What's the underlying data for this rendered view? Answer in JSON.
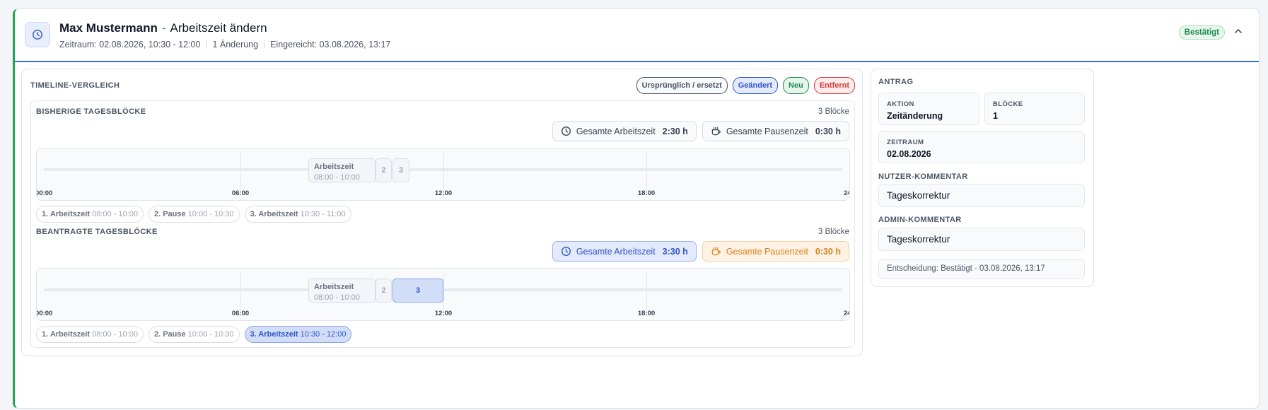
{
  "header": {
    "name": "Max Mustermann",
    "separator": "-",
    "title": "Arbeitszeit ändern",
    "period": "Zeitraum: 02.08.2026, 10:30 - 12:00",
    "changes": "1 Änderung",
    "submitted": "Eingereicht: 03.08.2026, 13:17",
    "status": "Bestätigt",
    "icons": {
      "main": "clock-icon",
      "collapse": "chevron-up-icon"
    }
  },
  "comparison": {
    "title": "Timeline-Vergleich",
    "legend": [
      "Ursprünglich / ersetzt",
      "Geändert",
      "Neu",
      "Entfernt"
    ],
    "colors": {
      "changed": "#2f56c6",
      "new": "#1f8a4c",
      "removed": "#d83a3a",
      "pause": "#d9821d"
    },
    "ticks": [
      "00:00",
      "06:00",
      "12:00",
      "18:00",
      "24:00"
    ],
    "previous": {
      "title": "Bisherige Tagesblöcke",
      "count": "3 Blöcke",
      "total_work_label": "Gesamte Arbeitszeit",
      "total_work_value": "2:30 h",
      "total_pause_label": "Gesamte Pausenzeit",
      "total_pause_value": "0:30 h",
      "segments": {
        "work_label": "Arbeitszeit",
        "work_range": "08:00 - 10:00",
        "b2": "2",
        "b3": "3"
      },
      "chips": [
        {
          "name": "1. Arbeitszeit",
          "range": "08:00 - 10:00"
        },
        {
          "name": "2. Pause",
          "range": "10:00 - 10:30"
        },
        {
          "name": "3. Arbeitszeit",
          "range": "10:30 - 11:00"
        }
      ]
    },
    "requested": {
      "title": "Beantragte Tagesblöcke",
      "count": "3 Blöcke",
      "total_work_label": "Gesamte Arbeitszeit",
      "total_work_value": "3:30 h",
      "total_pause_label": "Gesamte Pausenzeit",
      "total_pause_value": "0:30 h",
      "segments": {
        "work_label": "Arbeitszeit",
        "work_range": "08:00 - 10:00",
        "b2": "2",
        "b3": "3"
      },
      "chips": [
        {
          "name": "1. Arbeitszeit",
          "range": "08:00 - 10:00"
        },
        {
          "name": "2. Pause",
          "range": "10:00 - 10:30"
        },
        {
          "name": "3. Arbeitszeit",
          "range": "10:30 - 12:00"
        }
      ]
    }
  },
  "request": {
    "title": "Antrag",
    "action_label": "Aktion",
    "action_value": "Zeitänderung",
    "blocks_label": "Blöcke",
    "blocks_value": "1",
    "period_label": "Zeitraum",
    "period_value": "02.08.2026",
    "user_comment_label": "Nutzer-Kommentar",
    "user_comment": "Tageskorrektur",
    "admin_comment_label": "Admin-Kommentar",
    "admin_comment": "Tageskorrektur",
    "decision": "Entscheidung: Bestätigt · 03.08.2026, 13:17"
  }
}
